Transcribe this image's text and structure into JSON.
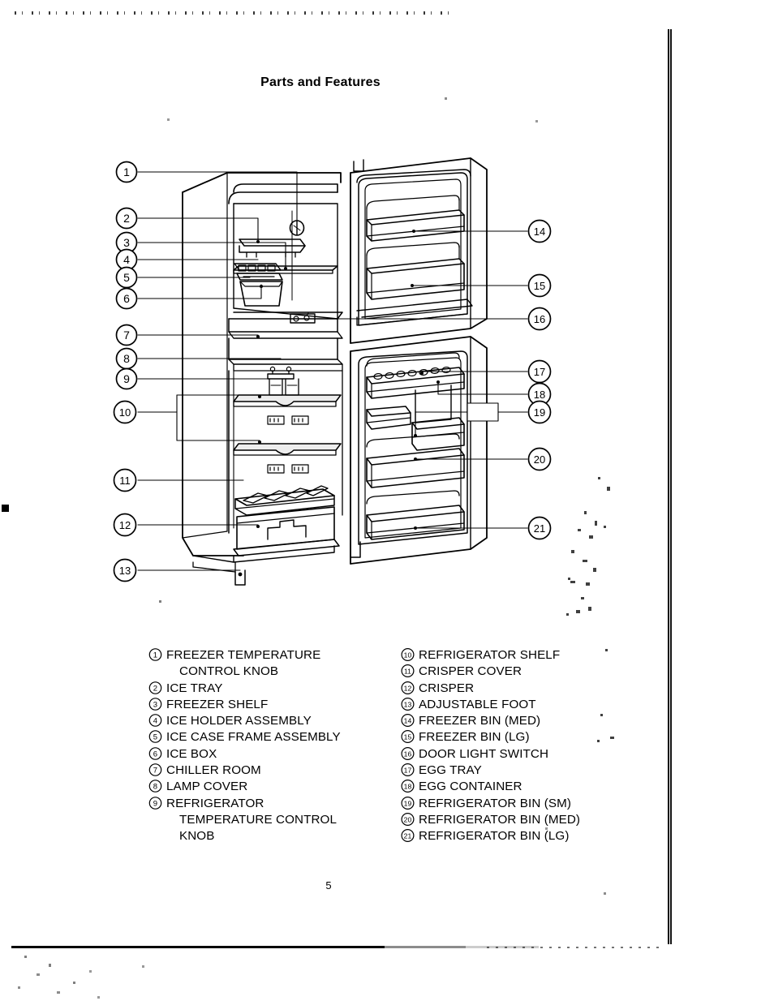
{
  "document": {
    "title": "Parts and Features",
    "page_number": "5"
  },
  "diagram": {
    "name": "refrigerator-parts-cutaway",
    "description": "Line drawing of a top-freezer refrigerator with both doors open, numbered callouts 1 through 21",
    "callouts_left": [
      "1",
      "2",
      "3",
      "4",
      "5",
      "6",
      "7",
      "8",
      "9",
      "10",
      "11",
      "12",
      "13"
    ],
    "callouts_right": [
      "14",
      "15",
      "16",
      "17",
      "18",
      "19",
      "20",
      "21"
    ]
  },
  "legend": {
    "left_column": [
      {
        "num": "1",
        "text": "FREEZER TEMPERATURE",
        "cont": "CONTROL KNOB"
      },
      {
        "num": "2",
        "text": "ICE TRAY",
        "cont": ""
      },
      {
        "num": "3",
        "text": "FREEZER SHELF",
        "cont": ""
      },
      {
        "num": "4",
        "text": "ICE HOLDER ASSEMBLY",
        "cont": ""
      },
      {
        "num": "5",
        "text": "ICE CASE FRAME ASSEMBLY",
        "cont": ""
      },
      {
        "num": "6",
        "text": "ICE BOX",
        "cont": ""
      },
      {
        "num": "7",
        "text": "CHILLER ROOM",
        "cont": ""
      },
      {
        "num": "8",
        "text": "LAMP COVER",
        "cont": ""
      },
      {
        "num": "9",
        "text": "REFRIGERATOR",
        "cont": "TEMPERATURE CONTROL\nKNOB"
      }
    ],
    "right_column": [
      {
        "num": "10",
        "text": "REFRIGERATOR SHELF",
        "cont": ""
      },
      {
        "num": "11",
        "text": "CRISPER COVER",
        "cont": ""
      },
      {
        "num": "12",
        "text": "CRISPER",
        "cont": ""
      },
      {
        "num": "13",
        "text": "ADJUSTABLE FOOT",
        "cont": ""
      },
      {
        "num": "14",
        "text": "FREEZER BIN (MED)",
        "cont": ""
      },
      {
        "num": "15",
        "text": "FREEZER BIN (LG)",
        "cont": ""
      },
      {
        "num": "16",
        "text": "DOOR LIGHT SWITCH",
        "cont": ""
      },
      {
        "num": "17",
        "text": "EGG TRAY",
        "cont": ""
      },
      {
        "num": "18",
        "text": "EGG CONTAINER",
        "cont": ""
      },
      {
        "num": "19",
        "text": "REFRIGERATOR BIN (SM)",
        "cont": ""
      },
      {
        "num": "20",
        "text": "REFRIGERATOR BIN (MED)",
        "cont": ""
      },
      {
        "num": "21",
        "text": "REFRIGERATOR BIN (LG)",
        "cont": ""
      }
    ]
  },
  "colors": {
    "ink": "#000000",
    "paper": "#ffffff"
  }
}
